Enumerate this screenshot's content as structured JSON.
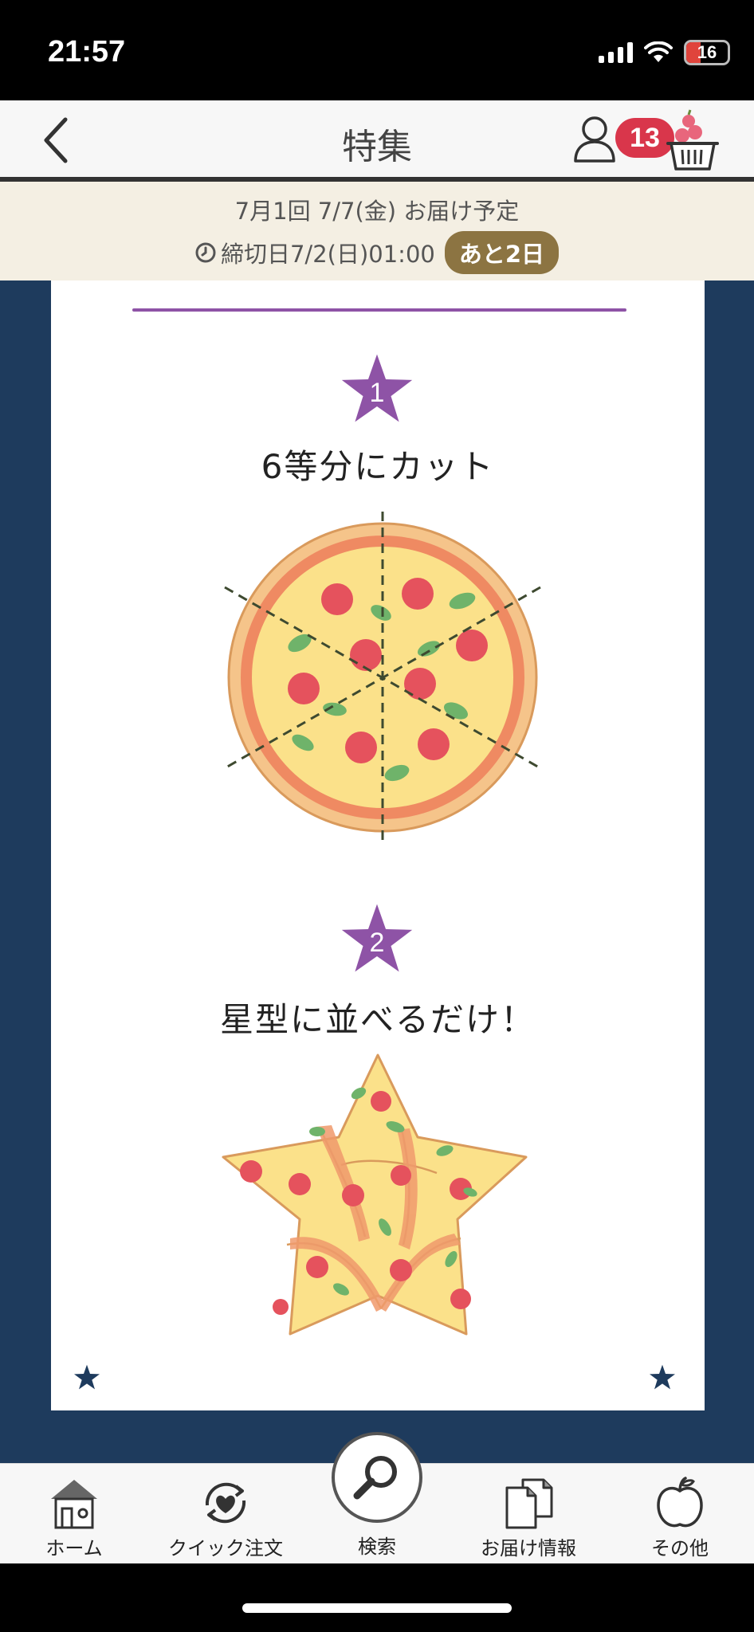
{
  "status_bar": {
    "time": "21:57",
    "battery": "16"
  },
  "header": {
    "title": "特集",
    "cart_count": "13"
  },
  "delivery": {
    "line1": "7月1回 7/7(金) お届け予定",
    "deadline": "締切日7/2(日)01:00",
    "remaining": "あと2日"
  },
  "steps": [
    {
      "number": "1",
      "caption": "6等分にカット"
    },
    {
      "number": "2",
      "caption": "星型に並べるだけ！"
    }
  ],
  "nav": {
    "home": "ホーム",
    "quick_order": "クイック注文",
    "search": "検索",
    "delivery_info": "お届け情報",
    "other": "その他"
  },
  "colors": {
    "accent_purple": "#8e53a6",
    "navy": "#1e3b5d",
    "badge_red": "#d9364b",
    "pill_brown": "#8c7442"
  }
}
